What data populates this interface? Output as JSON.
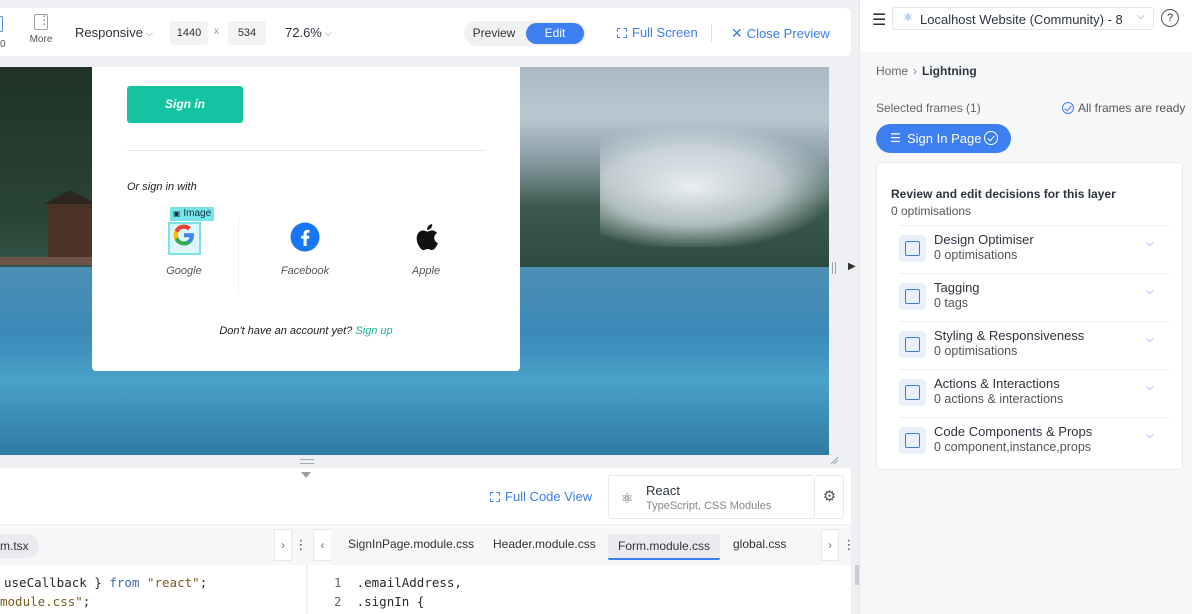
{
  "toolbar": {
    "zero_label": "0",
    "more_label": "More",
    "device": "Responsive",
    "width": "1440",
    "times": "x",
    "height": "534",
    "zoom": "72.6%",
    "preview_label": "Preview",
    "edit_label": "Edit",
    "full_screen_label": "Full Screen",
    "close_preview_label": "Close Preview"
  },
  "preview": {
    "signin_button": "Sign in",
    "or_sign_in_with": "Or sign in with",
    "image_tag": "Image",
    "social": [
      {
        "label": "Google",
        "icon": "google-icon"
      },
      {
        "label": "Facebook",
        "icon": "facebook-icon"
      },
      {
        "label": "Apple",
        "icon": "apple-icon"
      }
    ],
    "no_account": "Don't have an account yet?",
    "sign_up": "Sign up"
  },
  "code_header": {
    "full_code_view": "Full Code View",
    "framework": "React",
    "framework_detail": "TypeScript, CSS Modules"
  },
  "tabs": {
    "left_file": "m.tsx",
    "files": [
      "SignInPage.module.css",
      "Header.module.css",
      "Form.module.css",
      "global.css"
    ],
    "active_index": 2
  },
  "code_left": {
    "line1_text": "useCallback } ",
    "line1_kw": "from",
    "line1_str": "\"react\"",
    "line1_end": ";",
    "line2_str": "module.css\"",
    "line2_end": ";"
  },
  "code_right": {
    "lines": [
      {
        "num": "1",
        "text": ".emailAddress,"
      },
      {
        "num": "2",
        "text": ".signIn {"
      }
    ]
  },
  "right_panel": {
    "project": "Localhost Website (Community) - 8",
    "breadcrumb_home": "Home",
    "breadcrumb_current": "Lightning",
    "selected_frames": "Selected frames (1)",
    "all_ready": "All frames are ready",
    "chip_label": "Sign In Page",
    "review_title": "Review and edit decisions for this layer",
    "review_sub": "0 optimisations",
    "decisions": [
      {
        "name": "Design Optimiser",
        "value": "0 optimisations",
        "icon": "design-optimiser-icon"
      },
      {
        "name": "Tagging",
        "value": "0 tags",
        "icon": "tagging-icon"
      },
      {
        "name": "Styling & Responsiveness",
        "value": "0 optimisations",
        "icon": "styling-icon"
      },
      {
        "name": "Actions & Interactions",
        "value": "0 actions & interactions",
        "icon": "actions-icon"
      },
      {
        "name": "Code Components & Props",
        "value": "0 component,instance,props",
        "icon": "code-components-icon"
      }
    ]
  },
  "colors": {
    "accent": "#3d7ef0",
    "signin_green": "#14c4a0",
    "selection_cyan": "#79e3ea"
  }
}
